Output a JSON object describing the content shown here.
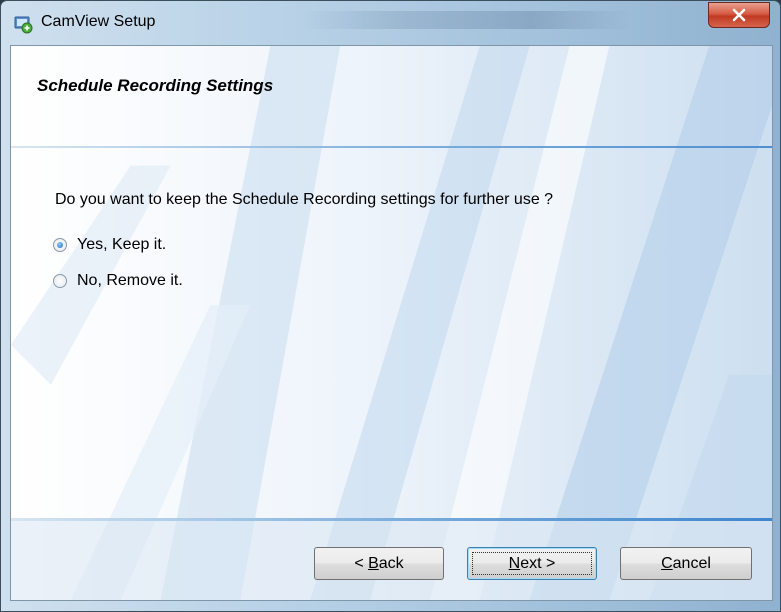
{
  "window": {
    "title": "CamView Setup"
  },
  "header": {
    "title": "Schedule Recording Settings"
  },
  "main": {
    "question": "Do you want to keep the Schedule Recording settings for further use ?",
    "options": [
      {
        "label": "Yes, Keep it.",
        "checked": true
      },
      {
        "label": "No, Remove it.",
        "checked": false
      }
    ]
  },
  "buttons": {
    "back_prefix": "< ",
    "back_mnemonic": "B",
    "back_rest": "ack",
    "next_mnemonic": "N",
    "next_rest": "ext >",
    "cancel_mnemonic": "C",
    "cancel_rest": "ancel"
  },
  "icons": {
    "app": "setup-app-icon",
    "close": "close-icon"
  },
  "colors": {
    "close": "#c9452f",
    "accent_line": "#4e8fcf"
  }
}
